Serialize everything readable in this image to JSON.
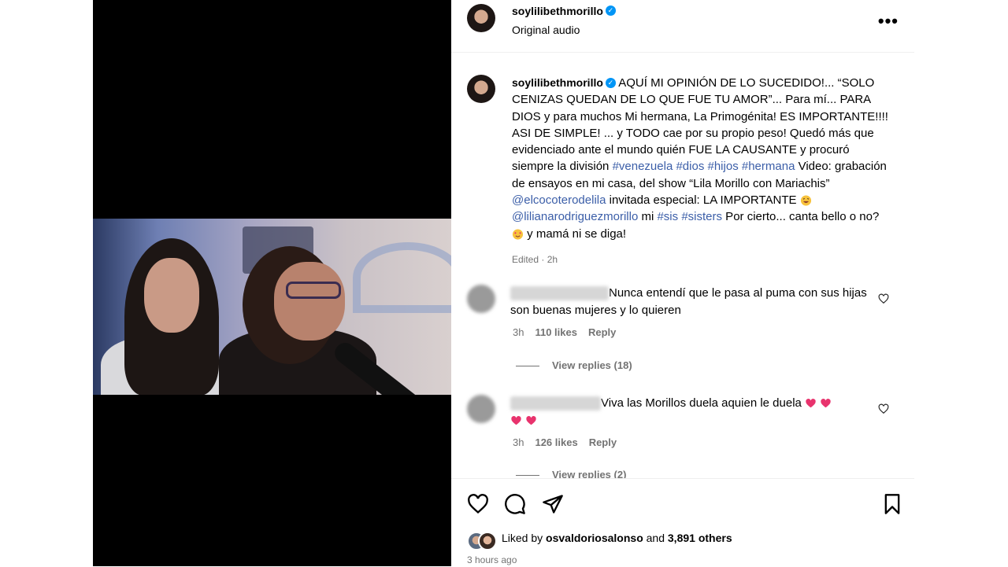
{
  "header": {
    "username": "soylilibethmorillo",
    "audio": "Original audio",
    "more_label": "•••"
  },
  "caption": {
    "username": "soylilibethmorillo",
    "parts": [
      " AQUÍ MI OPINIÓN DE LO SUCEDIDO!... “SOLO CENIZAS QUEDAN DE LO QUE FUE TU AMOR”... Para mí... PARA DIOS y para muchos Mi hermana, La Primogénita! ES IMPORTANTE!!!! ASI DE SIMPLE! ... y TODO cae por su propio peso! Quedó más que evidenciado ante el mundo quién FUE LA CAUSANTE y procuró siempre la división ",
      "#venezuela",
      " ",
      "#dios",
      " ",
      "#hijos",
      " ",
      "#hermana",
      " Video: grabación de ensayos en mi casa, del show “Lila Morillo con Mariachis” ",
      "@elcocoterodelila",
      " invitada especial: LA IMPORTANTE ",
      " ",
      "@lilianarodriguezmorillo",
      " mi ",
      "#sis",
      " ",
      "#sisters",
      " Por cierto... canta bello o no? ",
      " y mamá ni se diga!"
    ],
    "edited": "Edited · 2h"
  },
  "comments": [
    {
      "text": "Nunca entendí que le pasa al puma con sus hijas son buenas mujeres y lo quieren",
      "time": "3h",
      "likes": "110 likes",
      "reply": "Reply",
      "view_replies": "View replies (18)"
    },
    {
      "text": "Viva las Morillos duela aquien le duela",
      "time": "3h",
      "likes": "126 likes",
      "reply": "Reply",
      "view_replies": "View replies (2)"
    }
  ],
  "footer": {
    "liked_by": "Liked by",
    "liker": "osvaldoriosalonso",
    "and": "and",
    "others": "3,891 others",
    "posted": "3 hours ago"
  },
  "colors": {
    "link": "#3b5ea8",
    "verified": "#0095f6",
    "muted": "#737373",
    "heart": "#e8336d"
  }
}
